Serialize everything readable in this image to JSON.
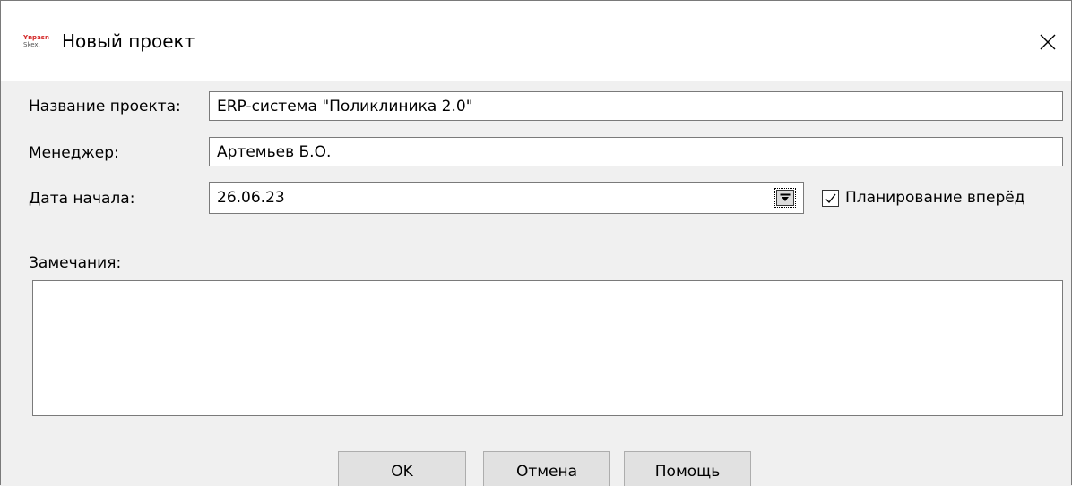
{
  "window": {
    "title": "Новый проект",
    "app_icon": "app-logo-icon",
    "close_icon": "close-icon"
  },
  "form": {
    "project_name": {
      "label": "Название проекта:",
      "value": "ERP-система \"Поликлиника 2.0\""
    },
    "manager": {
      "label": "Менеджер:",
      "value": "Артемьев Б.О."
    },
    "start_date": {
      "label": "Дата начала:",
      "value": "26.06.23",
      "dropdown_icon": "calendar-dropdown-icon"
    },
    "forward_planning": {
      "label": "Планирование вперёд",
      "checked": true
    },
    "notes": {
      "label": "Замечания:",
      "value": ""
    }
  },
  "buttons": {
    "ok": "OK",
    "cancel": "Отмена",
    "help": "Помощь"
  },
  "colors": {
    "window_bg": "#f0f0f0",
    "titlebar_bg": "#ffffff",
    "border": "#7a7a7a",
    "button_bg": "#e1e1e1",
    "logo_red": "#d42a2a"
  }
}
